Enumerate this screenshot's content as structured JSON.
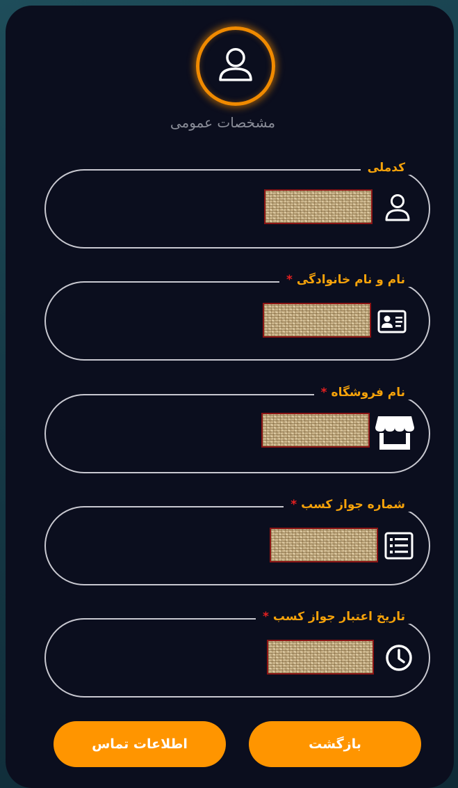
{
  "header": {
    "section_title": "مشخصات عمومی",
    "avatar_icon": "user-icon"
  },
  "form": {
    "fields": [
      {
        "label": "کدملی",
        "required": false,
        "icon": "user-icon",
        "value_redacted": true
      },
      {
        "label": "نام و نام خانوادگی",
        "required": true,
        "icon": "id-card-icon",
        "value_redacted": true
      },
      {
        "label": "نام فروشگاه",
        "required": true,
        "icon": "store-icon",
        "value_redacted": true
      },
      {
        "label": "شماره جواز کسب",
        "required": true,
        "icon": "list-icon",
        "value_redacted": true
      },
      {
        "label": "تاریخ اعتبار جواز کسب",
        "required": true,
        "icon": "clock-icon",
        "value_redacted": true
      }
    ],
    "required_mark": "*"
  },
  "buttons": {
    "back_label": "بازگشت",
    "contact_label": "اطلاعات تماس"
  },
  "colors": {
    "accent": "#ff9500",
    "label": "#f5a20a",
    "required": "#e62020",
    "card_bg": "#0b0e1e"
  }
}
